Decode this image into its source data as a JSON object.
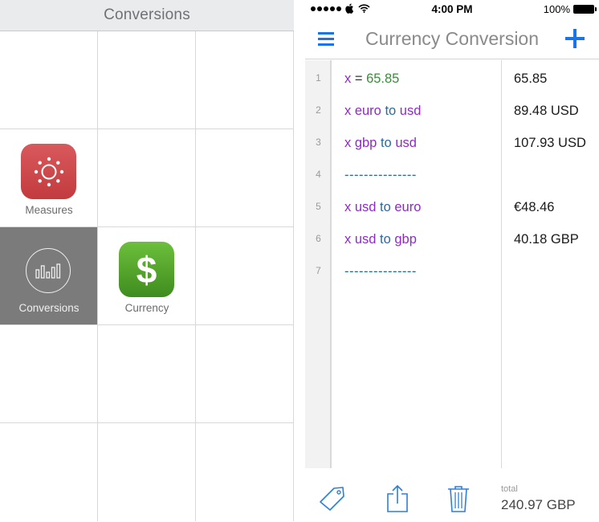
{
  "left": {
    "header_title": "Conversions",
    "apps": [
      {
        "label": "Measures",
        "icon": "sun-icon",
        "color": "#cf4a4d"
      },
      {
        "label": "Conversions",
        "icon": "bar-chart-circle-icon",
        "selected": true
      },
      {
        "label": "Currency",
        "icon": "dollar-icon",
        "color": "#52a52c"
      }
    ]
  },
  "right": {
    "status": {
      "signal_dots": 5,
      "time": "4:00 PM",
      "battery_percent": "100%"
    },
    "nav": {
      "title": "Currency Conversion",
      "menu_icon": "hamburger-menu-icon",
      "add_icon": "plus-icon"
    },
    "lines": [
      {
        "num": "1",
        "tokens": [
          {
            "t": "x",
            "c": "var"
          },
          {
            "t": " = ",
            "c": "op"
          },
          {
            "t": "65.85",
            "c": "num"
          }
        ],
        "result": "65.85"
      },
      {
        "num": "2",
        "tokens": [
          {
            "t": "x",
            "c": "var"
          },
          {
            "t": " euro",
            "c": "unit"
          },
          {
            "t": " to",
            "c": "kw"
          },
          {
            "t": " usd",
            "c": "unit"
          }
        ],
        "result": "89.48 USD"
      },
      {
        "num": "3",
        "tokens": [
          {
            "t": "x",
            "c": "var"
          },
          {
            "t": " gbp",
            "c": "unit"
          },
          {
            "t": " to",
            "c": "kw"
          },
          {
            "t": " usd",
            "c": "unit"
          }
        ],
        "result": "107.93 USD"
      },
      {
        "num": "4",
        "tokens": [
          {
            "t": "---------------",
            "c": "sep"
          }
        ],
        "result": ""
      },
      {
        "num": "5",
        "tokens": [
          {
            "t": "x",
            "c": "var"
          },
          {
            "t": " usd",
            "c": "unit"
          },
          {
            "t": " to",
            "c": "kw"
          },
          {
            "t": " euro",
            "c": "unit"
          }
        ],
        "result": "€48.46"
      },
      {
        "num": "6",
        "tokens": [
          {
            "t": "x",
            "c": "var"
          },
          {
            "t": " usd",
            "c": "unit"
          },
          {
            "t": " to",
            "c": "kw"
          },
          {
            "t": " gbp",
            "c": "unit"
          }
        ],
        "result": "40.18 GBP"
      },
      {
        "num": "7",
        "tokens": [
          {
            "t": "---------------",
            "c": "sep"
          }
        ],
        "result": ""
      }
    ],
    "toolbar": {
      "tag_icon": "tag-icon",
      "share_icon": "share-icon",
      "trash_icon": "trash-icon",
      "total_label": "total",
      "total_value": "240.97 GBP"
    },
    "accent_color": "#1a73e8"
  }
}
